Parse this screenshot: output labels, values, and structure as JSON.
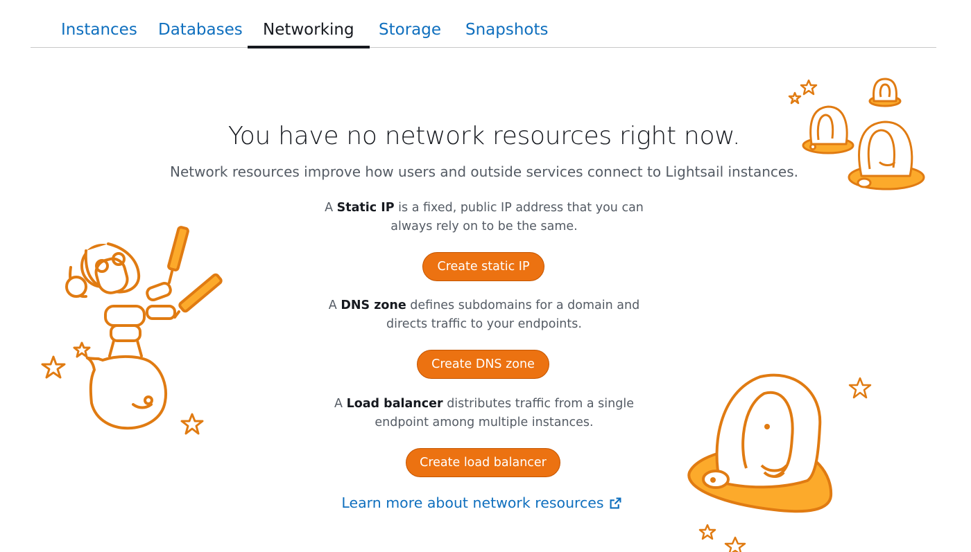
{
  "tabs": {
    "instances": "Instances",
    "databases": "Databases",
    "networking": "Networking",
    "storage": "Storage",
    "snapshots": "Snapshots",
    "active": "Networking"
  },
  "empty_state": {
    "title": "You have no network resources right now.",
    "subtitle": "Network resources improve how users and outside services connect to Lightsail instances."
  },
  "static_ip": {
    "prefix": "A ",
    "term": "Static IP",
    "rest": " is a fixed, public IP address that you can always rely on to be the same.",
    "button": "Create static IP"
  },
  "dns_zone": {
    "prefix": "A ",
    "term": "DNS zone",
    "rest": " defines subdomains for a domain and directs traffic to your endpoints.",
    "button": "Create DNS zone"
  },
  "load_balancer": {
    "prefix": "A ",
    "term": "Load balancer",
    "rest": " distributes traffic from a single endpoint among multiple instances.",
    "button": "Create load balancer"
  },
  "learn_more": {
    "label": "Learn more about network resources",
    "icon": "external-link-icon"
  },
  "colors": {
    "accent": "#ec7211",
    "link": "#0f6fbe",
    "illustration_stroke": "#e07b12",
    "illustration_fill": "#fcaa2b"
  }
}
